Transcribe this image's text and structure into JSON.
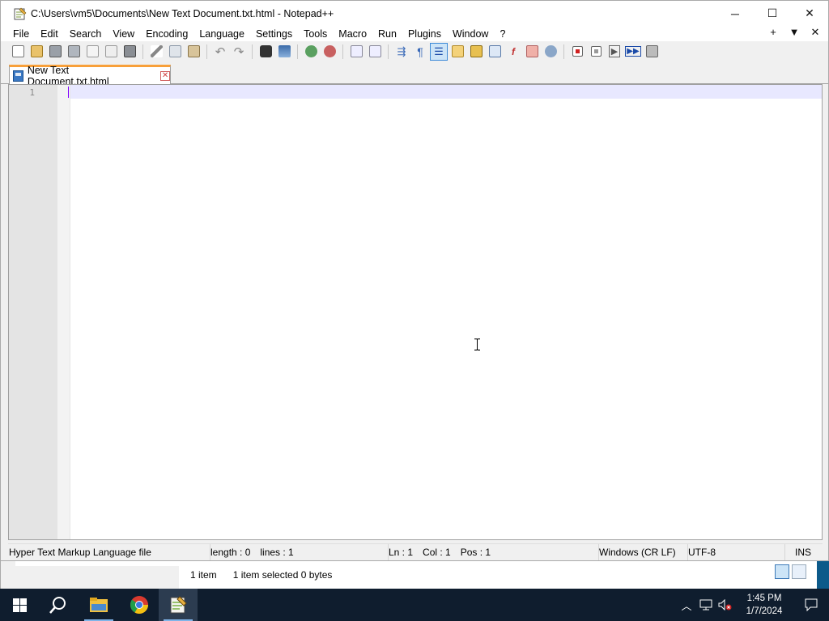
{
  "window": {
    "title": "C:\\Users\\vm5\\Documents\\New Text Document.txt.html - Notepad++",
    "minimize": "─",
    "maximize": "☐",
    "close": "✕"
  },
  "menu": {
    "items": [
      "File",
      "Edit",
      "Search",
      "View",
      "Encoding",
      "Language",
      "Settings",
      "Tools",
      "Macro",
      "Run",
      "Plugins",
      "Window",
      "?"
    ],
    "right_controls": [
      "+",
      "▼",
      "✕"
    ]
  },
  "toolbar": {
    "groups": [
      [
        "new-file-icon",
        "open-file-icon",
        "save-icon",
        "save-all-icon",
        "close-icon",
        "close-all-icon",
        "print-icon"
      ],
      [
        "cut-icon",
        "copy-icon",
        "paste-icon"
      ],
      [
        "undo-icon",
        "redo-icon"
      ],
      [
        "find-icon",
        "replace-icon"
      ],
      [
        "zoom-in-icon",
        "zoom-out-icon"
      ],
      [
        "sync-vertical-icon",
        "sync-horizontal-icon"
      ],
      [
        "word-wrap-icon",
        "show-all-chars-icon",
        "indent-guide-icon",
        "user-language-icon",
        "doc-map-icon",
        "doc-list-icon",
        "function-list-icon",
        "folder-workspace-icon",
        "monitoring-icon"
      ],
      [
        "macro-record-icon",
        "macro-stop-icon",
        "macro-play-icon",
        "macro-run-multiple-icon",
        "macro-save-icon"
      ]
    ],
    "active": "indent-guide-icon"
  },
  "tab": {
    "label": "New Text Document.txt.html",
    "close": "✕"
  },
  "editor": {
    "line_numbers": [
      "1"
    ],
    "content": ""
  },
  "status": {
    "file_type": "Hyper Text Markup Language file",
    "length": "length : 0",
    "lines": "lines : 1",
    "ln": "Ln : 1",
    "col": "Col : 1",
    "pos": "Pos : 1",
    "eol": "Windows (CR LF)",
    "encoding": "UTF-8",
    "mode": "INS"
  },
  "explorer_status": {
    "items": "1 item",
    "selected": "1 item selected  0 bytes"
  },
  "taskbar": {
    "apps": [
      "start-icon",
      "search-icon",
      "file-explorer-icon",
      "chrome-icon",
      "notepadpp-icon"
    ],
    "active_app": "notepadpp-icon",
    "time": "1:45 PM",
    "date": "1/7/2024"
  },
  "colors": {
    "tab_accent": "#f8a03a",
    "caret": "#8000ff",
    "current_line": "#e8e8ff",
    "taskbar": "#0f1d2e"
  }
}
